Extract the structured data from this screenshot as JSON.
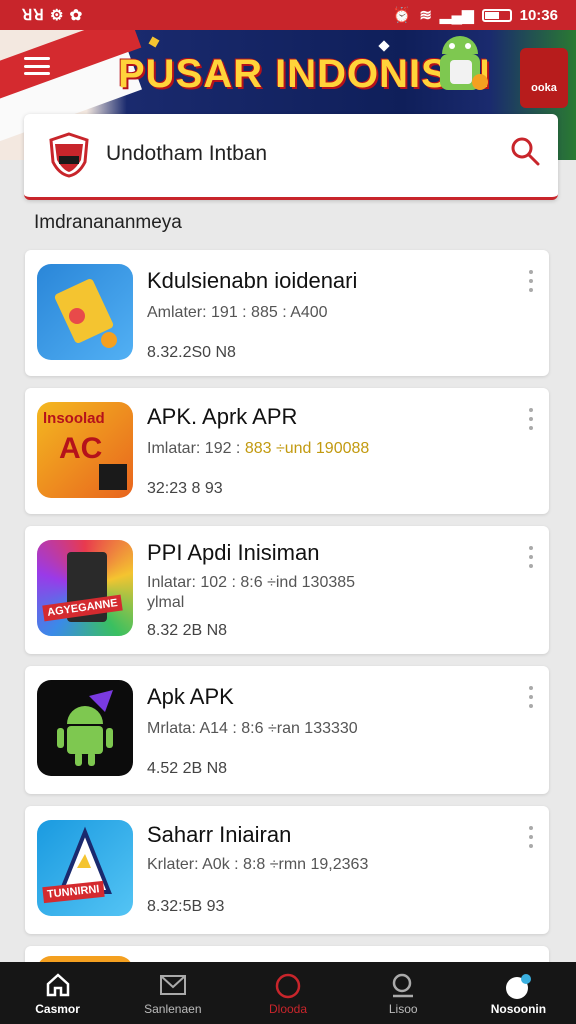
{
  "status_bar": {
    "left": "ꓤꓤ ⚙ ✿",
    "time": "10:36",
    "battery_level": 0.6
  },
  "banner": {
    "title": "PUSAR INDONISIN",
    "logo_text": "ooka"
  },
  "search": {
    "logo_text": "ᴀᴀᴀ",
    "text": "Undotham Intban"
  },
  "section": {
    "title": "Imdranananmeya"
  },
  "apps": [
    {
      "title": "Kdulsienabn ioidenari",
      "meta": "Amlater: 191 : 885 : A400",
      "meta_highlight": "",
      "sub": "",
      "size": "8.32.2S0 N8",
      "icon_label": "",
      "icon_colors": [
        "#2a86d8",
        "#3aa0f0"
      ]
    },
    {
      "title": "APK. Aprk APR",
      "meta": "Imlatar: 192 : ",
      "meta_highlight": "883 ÷und 190088",
      "sub": "",
      "size": "32:23 8 93",
      "icon_label": "AC",
      "icon_top": "lnsoolad",
      "icon_colors": [
        "#f0a81c",
        "#e25a1e"
      ]
    },
    {
      "title": "PPI Apdi Inisiman",
      "meta": "Inlatar: 102 : 8:6 ÷ind 130385",
      "meta_highlight": "",
      "sub": "ylmal",
      "size": "8.32 2B N8",
      "icon_label": "AGYEGANNE",
      "icon_colors": [
        "#e83a4e",
        "#3a8ae8"
      ]
    },
    {
      "title": "Apk APK",
      "meta": "Mrlata: A14 : 8:6 ÷ran 133330",
      "meta_highlight": "",
      "sub": "",
      "size": "4.52 2B N8",
      "icon_label": "",
      "icon_colors": [
        "#0c0c0c",
        "#0c0c0c"
      ]
    },
    {
      "title": "Saharr Iniairan",
      "meta": "Krlater: A0k : 8:8 ÷rmn 19,2363",
      "meta_highlight": "",
      "sub": "",
      "size": "8.32:5B 93",
      "icon_label": "TUNNIRNI",
      "icon_colors": [
        "#1a9ae0",
        "#45c0f0"
      ]
    }
  ],
  "nav": [
    {
      "label": "Casmor",
      "icon": "home-icon"
    },
    {
      "label": "Sanlenaen",
      "icon": "mail-icon"
    },
    {
      "label": "Dlooda",
      "icon": "circle-icon"
    },
    {
      "label": "Lisoo",
      "icon": "search-icon"
    },
    {
      "label": "Nosoonin",
      "icon": "profile-icon"
    }
  ],
  "colors": {
    "accent": "#c8252b",
    "nav_bg": "#161616",
    "highlight": "#c29a10"
  }
}
